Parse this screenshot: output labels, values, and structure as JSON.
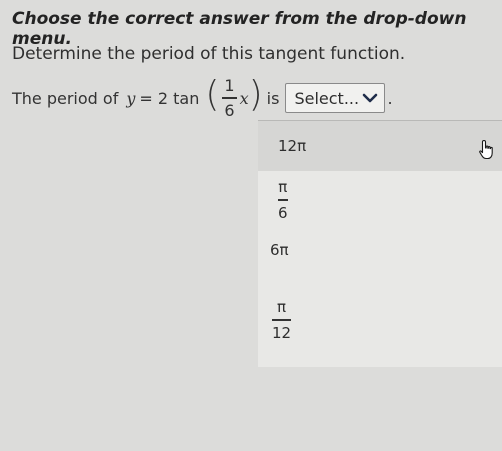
{
  "instruction": "Choose the correct answer from the drop-down menu.",
  "question": "Determine the period of this tangent function.",
  "prompt": {
    "lead": "The period of",
    "equation": {
      "var_y": "y",
      "eq": "= 2 tan",
      "num": "1",
      "den": "6",
      "var_x": "x"
    },
    "connector": "is",
    "trail": "."
  },
  "select": {
    "value": "Select...",
    "icon": "chevron-down-icon"
  },
  "options": [
    {
      "text": "12π"
    },
    {
      "num": "π",
      "den": "6"
    },
    {
      "text": "6π"
    },
    {
      "num": "π",
      "den": "12"
    }
  ],
  "cursor": {
    "icon": "hand-pointer-icon"
  }
}
